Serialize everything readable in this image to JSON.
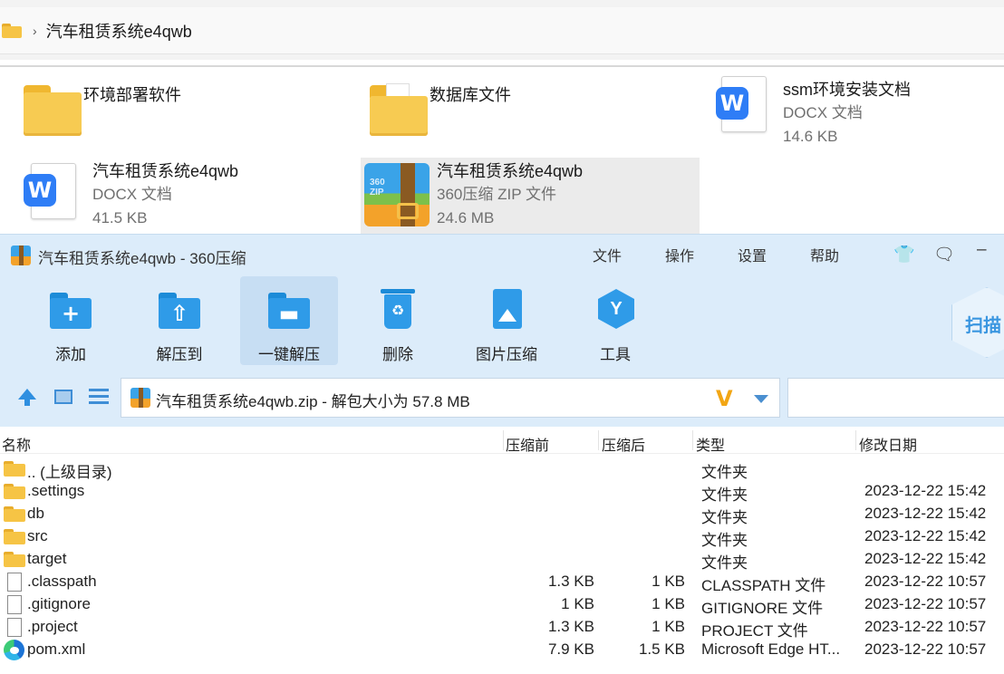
{
  "explorer": {
    "breadcrumb": "汽车租赁系统e4qwb",
    "items": [
      {
        "name": "环境部署软件",
        "type": "",
        "size": ""
      },
      {
        "name": "数据库文件",
        "type": "",
        "size": ""
      },
      {
        "name": "ssm环境安装文档",
        "type": "DOCX 文档",
        "size": "14.6 KB"
      },
      {
        "name": "汽车租赁系统e4qwb",
        "type": "DOCX 文档",
        "size": "41.5 KB"
      },
      {
        "name": "汽车租赁系统e4qwb",
        "type": "360压缩 ZIP 文件",
        "size": "24.6 MB"
      }
    ]
  },
  "app": {
    "title": "汽车租赁系统e4qwb - 360压缩",
    "menu": [
      "文件",
      "操作",
      "设置",
      "帮助"
    ],
    "toolbar": [
      "添加",
      "解压到",
      "一键解压",
      "删除",
      "图片压缩",
      "工具"
    ],
    "scan_label": "扫描",
    "path": "汽车租赁系统e4qwb.zip - 解包大小为 57.8 MB"
  },
  "table": {
    "columns": [
      "名称",
      "压缩前",
      "压缩后",
      "类型",
      "修改日期"
    ],
    "rows": [
      {
        "name": ".. (上级目录)",
        "before": "",
        "after": "",
        "type": "文件夹",
        "date": "",
        "icon": "folder-icon"
      },
      {
        "name": ".settings",
        "before": "",
        "after": "",
        "type": "文件夹",
        "date": "2023-12-22 15:42",
        "icon": "folder-icon"
      },
      {
        "name": "db",
        "before": "",
        "after": "",
        "type": "文件夹",
        "date": "2023-12-22 15:42",
        "icon": "folder-icon"
      },
      {
        "name": "src",
        "before": "",
        "after": "",
        "type": "文件夹",
        "date": "2023-12-22 15:42",
        "icon": "folder-icon"
      },
      {
        "name": "target",
        "before": "",
        "after": "",
        "type": "文件夹",
        "date": "2023-12-22 15:42",
        "icon": "folder-icon"
      },
      {
        "name": ".classpath",
        "before": "1.3 KB",
        "after": "1 KB",
        "type": "CLASSPATH 文件",
        "date": "2023-12-22 10:57",
        "icon": "file-icon"
      },
      {
        "name": ".gitignore",
        "before": "1 KB",
        "after": "1 KB",
        "type": "GITIGNORE 文件",
        "date": "2023-12-22 10:57",
        "icon": "file-icon"
      },
      {
        "name": ".project",
        "before": "1.3 KB",
        "after": "1 KB",
        "type": "PROJECT 文件",
        "date": "2023-12-22 10:57",
        "icon": "file-icon"
      },
      {
        "name": "pom.xml",
        "before": "7.9 KB",
        "after": "1.5 KB",
        "type": "Microsoft Edge HT...",
        "date": "2023-12-22 10:57",
        "icon": "edge-icon"
      }
    ]
  },
  "colors": {
    "accent": "#2f9be8",
    "window_bg": "#dcecfa",
    "folder": "#f7cb52"
  }
}
